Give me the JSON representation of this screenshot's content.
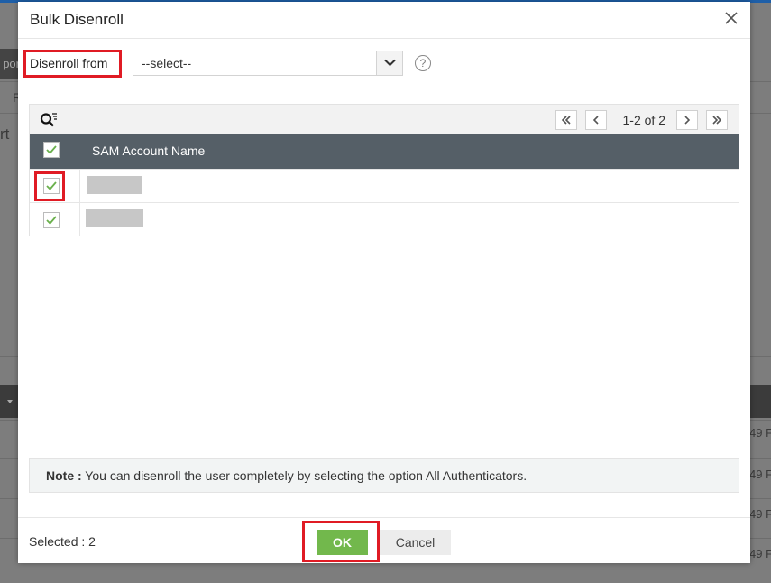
{
  "modal": {
    "title": "Bulk Disenroll",
    "close_icon": "close-icon",
    "disenroll_label": "Disenroll from",
    "disenroll_select": {
      "value": "--select--"
    },
    "help_icon": "?"
  },
  "grid": {
    "pager_text": "1-2 of 2",
    "column_header": "SAM Account Name",
    "header_checked": true,
    "rows": [
      {
        "checked": true,
        "name": ""
      },
      {
        "checked": true,
        "name": ""
      }
    ]
  },
  "note": {
    "label": "Note :",
    "text": " You can disenroll the user completely by selecting the option All Authenticators."
  },
  "footer": {
    "selected_text": "Selected : 2",
    "ok_label": "OK",
    "cancel_label": "Cancel"
  },
  "background": {
    "tab_fragment": "por",
    "text_r": "R",
    "text_rt": "rt",
    "row_fragment": "49 F"
  },
  "colors": {
    "accent_green": "#72b84c",
    "header_gray": "#555f67",
    "highlight_red": "#e01b24"
  }
}
